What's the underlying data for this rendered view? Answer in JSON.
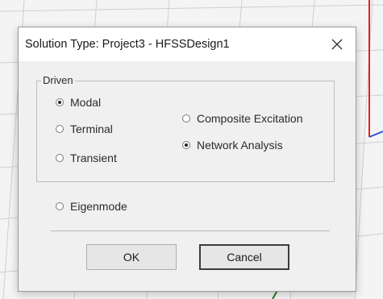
{
  "dialog": {
    "title": "Solution Type: Project3 - HFSSDesign1",
    "close_glyph": "✕",
    "group_label": "Driven",
    "radios": {
      "modal": {
        "label": "Modal",
        "checked": true
      },
      "terminal": {
        "label": "Terminal",
        "checked": false
      },
      "transient": {
        "label": "Transient",
        "checked": false
      },
      "composite": {
        "label": "Composite Excitation",
        "checked": false
      },
      "network": {
        "label": "Network Analysis",
        "checked": true
      },
      "eigenmode": {
        "label": "Eigenmode",
        "checked": false
      }
    },
    "ok_label": "OK",
    "cancel_label": "Cancel"
  },
  "colors": {
    "axis_red": "#e02020",
    "axis_blue": "#2f55d4",
    "axis_green": "#1f7a2a",
    "grid": "#cfcfcf"
  }
}
